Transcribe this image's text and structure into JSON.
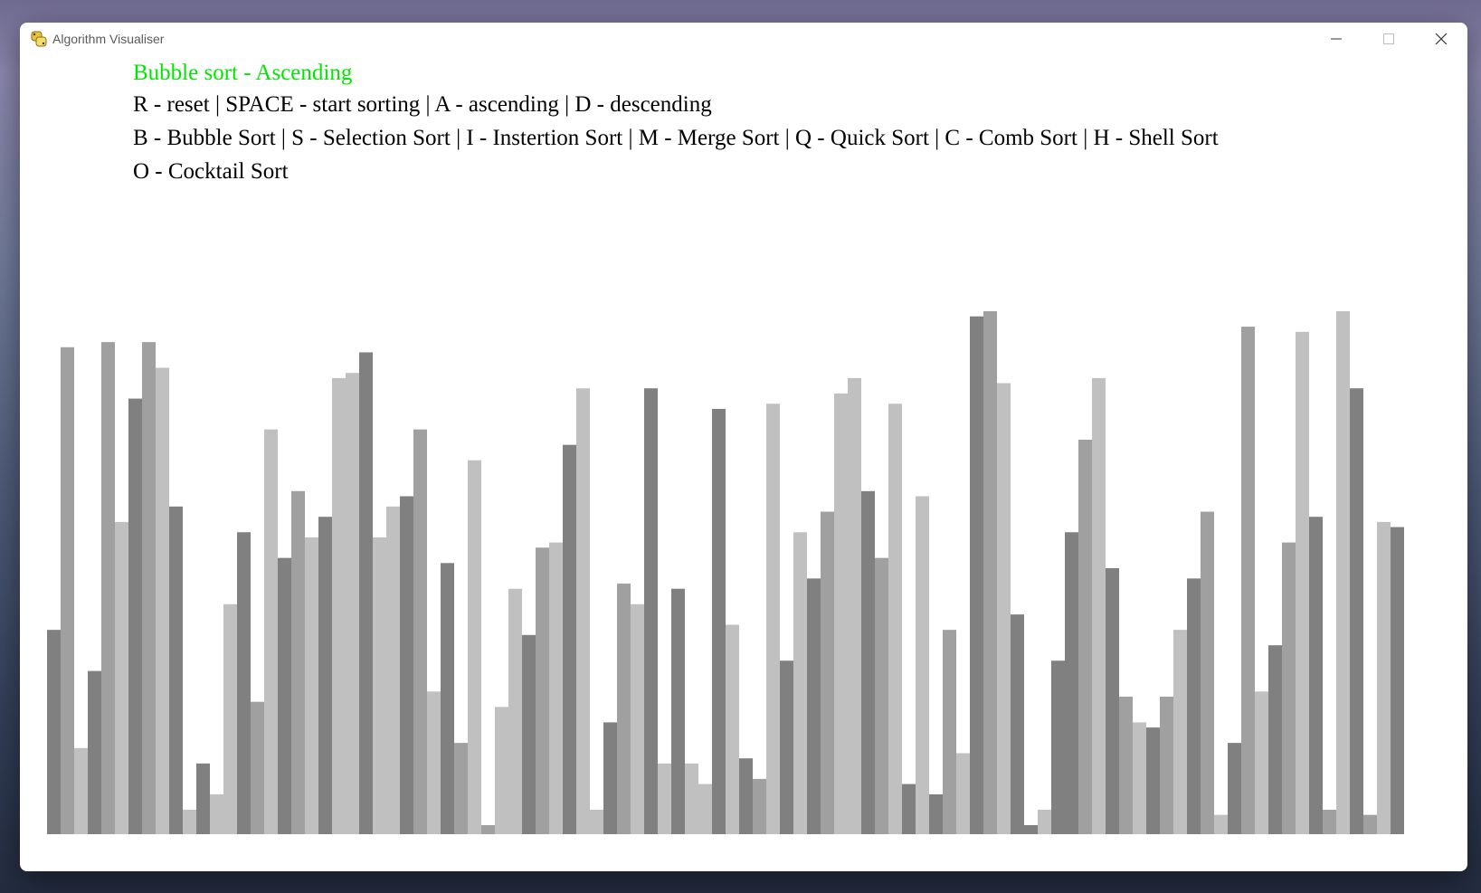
{
  "window": {
    "title": "Algorithm Visualiser",
    "icon": "python-icon",
    "controls": [
      "minimize-icon",
      "maximize-icon",
      "close-icon"
    ]
  },
  "header": {
    "status": "Bubble sort - Ascending",
    "status_color": "#00e600",
    "controls_line": "R - reset | SPACE - start sorting | A - ascending | D - descending",
    "algorithms_line": "B - Bubble Sort | S - Selection Sort | I - Instertion Sort | M - Merge Sort | Q - Quick Sort | C - Comb Sort | H - Shell Sort",
    "algorithms_line2": "O - Cocktail Sort"
  },
  "visualization": {
    "bar_colors": [
      "#808080",
      "#a0a0a0",
      "#c0c0c0"
    ],
    "min_value": 0,
    "max_value": 100,
    "values": [
      38,
      93,
      15,
      30,
      94,
      59,
      83,
      94,
      89,
      62,
      3,
      12,
      6,
      43,
      57,
      24,
      77,
      52,
      65,
      56,
      60,
      87,
      88,
      92,
      56,
      62,
      64,
      77,
      26,
      51,
      16,
      71,
      0,
      23,
      46,
      37,
      54,
      55,
      74,
      85,
      3,
      20,
      47,
      43,
      85,
      12,
      46,
      12,
      8,
      81,
      39,
      13,
      9,
      82,
      32,
      57,
      48,
      61,
      84,
      87,
      65,
      52,
      82,
      8,
      64,
      6,
      38,
      14,
      99,
      100,
      86,
      41,
      0,
      3,
      32,
      57,
      75,
      87,
      50,
      25,
      20,
      19,
      25,
      38,
      48,
      61,
      2,
      16,
      97,
      26,
      35,
      55,
      96,
      60,
      3,
      100,
      85,
      2,
      59,
      58
    ],
    "shades": [
      0,
      1,
      2,
      0,
      1,
      2,
      0,
      1,
      2,
      0,
      2,
      0,
      2,
      2,
      0,
      1,
      2,
      0,
      1,
      2,
      0,
      2,
      2,
      0,
      2,
      2,
      0,
      1,
      2,
      0,
      1,
      2,
      1,
      2,
      2,
      0,
      1,
      2,
      0,
      2,
      2,
      0,
      1,
      2,
      0,
      2,
      0,
      2,
      2,
      0,
      2,
      0,
      1,
      2,
      0,
      2,
      0,
      1,
      2,
      2,
      0,
      1,
      2,
      0,
      2,
      0,
      1,
      2,
      0,
      1,
      2,
      0,
      0,
      2,
      0,
      0,
      1,
      2,
      0,
      1,
      2,
      0,
      1,
      2,
      0,
      1,
      2,
      0,
      1,
      2,
      0,
      1,
      2,
      0,
      1,
      2,
      0,
      1,
      2,
      0
    ]
  }
}
